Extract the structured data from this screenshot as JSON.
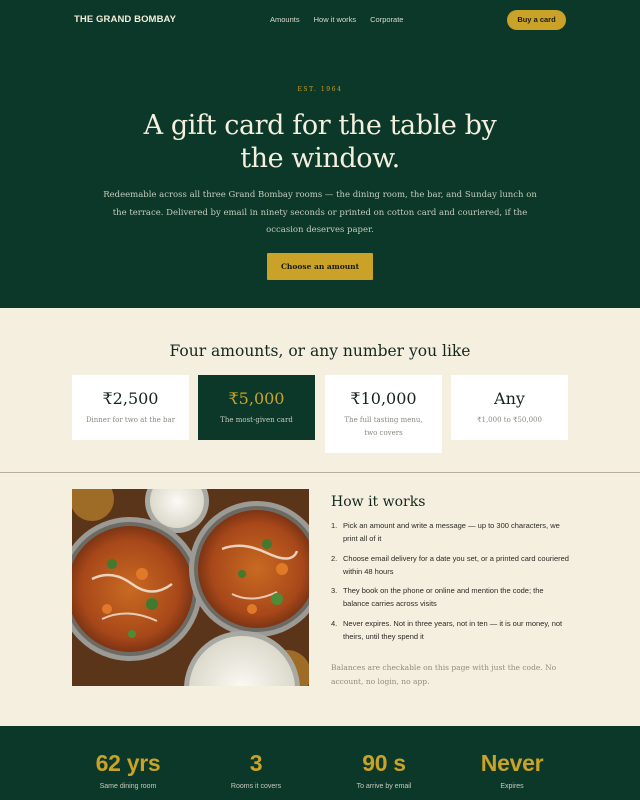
{
  "nav": {
    "logo": "THE GRAND BOMBAY",
    "links": [
      "Amounts",
      "How it works",
      "Corporate"
    ],
    "cta": "Buy a card"
  },
  "hero": {
    "eyebrow": "EST. 1964",
    "title": "A gift card for the table by the window.",
    "subtitle": "Redeemable across all three Grand Bombay rooms — the dining room, the bar, and Sunday lunch on the terrace. Delivered by email in ninety seconds or printed on cotton card and couriered, if the occasion deserves paper.",
    "cta": "Choose an amount"
  },
  "amounts": {
    "title": "Four amounts, or any number you like",
    "cards": [
      {
        "value": "₹2,500",
        "desc": "Dinner for two at the bar"
      },
      {
        "value": "₹5,000",
        "desc": "The most-given card"
      },
      {
        "value": "₹10,000",
        "desc": "The full tasting menu, two covers"
      },
      {
        "value": "Any",
        "desc": "₹1,000 to ₹50,000"
      }
    ],
    "selected_index": 1
  },
  "how": {
    "title": "How it works",
    "steps": [
      "Pick an amount and write a message — up to 300 characters, we print all of it",
      "Choose email delivery for a date you set, or a printed card couriered within 48 hours",
      "They book on the phone or online and mention the code; the balance carries across visits",
      "Never expires. Not in three years, not in ten — it is our money, not theirs, until they spend it"
    ],
    "note": "Balances are checkable on this page with just the code. No account, no login, no app."
  },
  "stats": [
    {
      "value": "62 yrs",
      "label": "Same dining room"
    },
    {
      "value": "3",
      "label": "Rooms it covers"
    },
    {
      "value": "90 s",
      "label": "To arrive by email"
    },
    {
      "value": "Never",
      "label": "Expires"
    }
  ],
  "colors": {
    "brand_green": "#0c3829",
    "accent_gold": "#c9a227",
    "cream": "#f5efe0"
  }
}
